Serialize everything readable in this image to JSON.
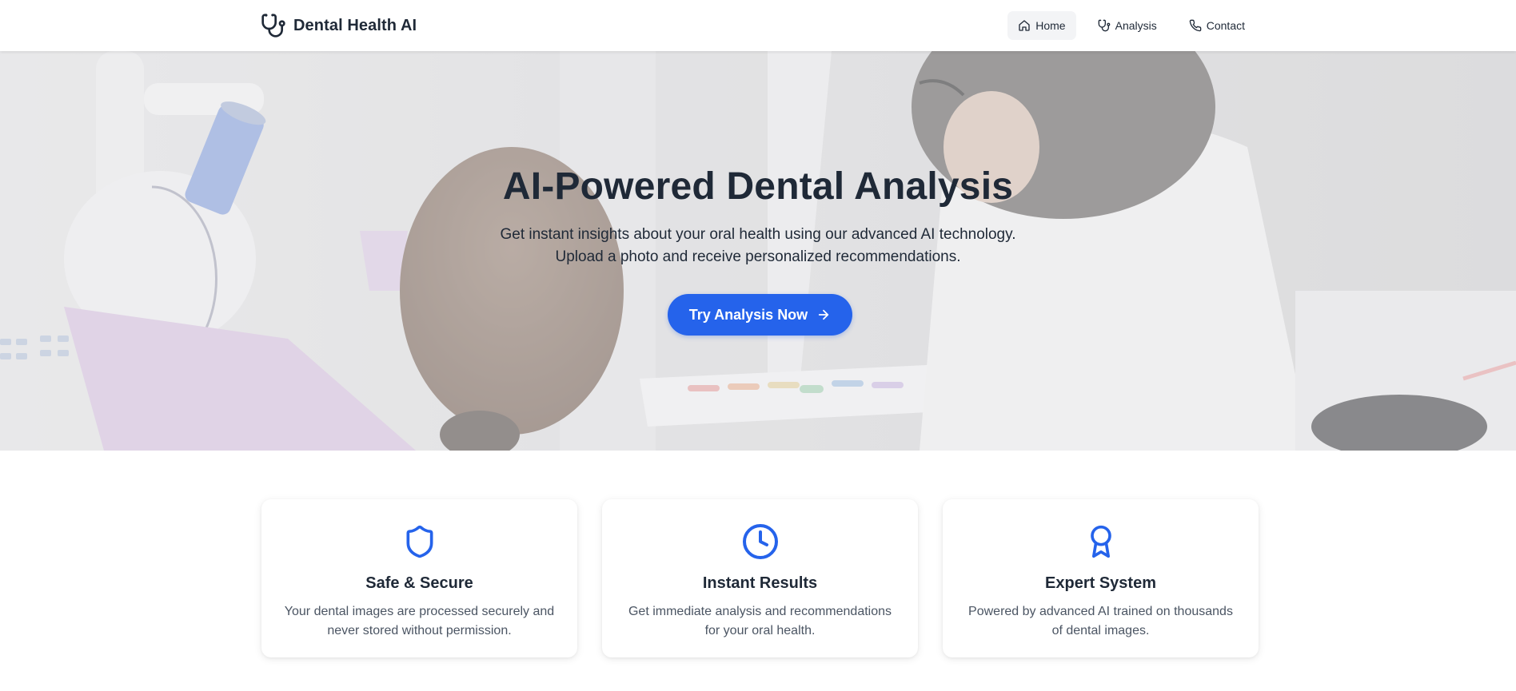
{
  "brand": {
    "name": "Dental Health AI",
    "icon": "stethoscope-icon"
  },
  "nav": [
    {
      "label": "Home",
      "icon": "home-icon",
      "active": true
    },
    {
      "label": "Analysis",
      "icon": "stethoscope-icon",
      "active": false
    },
    {
      "label": "Contact",
      "icon": "phone-icon",
      "active": false
    }
  ],
  "hero": {
    "title": "AI-Powered Dental Analysis",
    "subtitle": "Get instant insights about your oral health using our advanced AI technology. Upload a photo and receive personalized recommendations.",
    "cta_label": "Try Analysis Now",
    "cta_icon": "arrow-right-icon"
  },
  "features": [
    {
      "icon": "shield-icon",
      "title": "Safe & Secure",
      "description": "Your dental images are processed securely and never stored without permission."
    },
    {
      "icon": "clock-icon",
      "title": "Instant Results",
      "description": "Get immediate analysis and recommendations for your oral health."
    },
    {
      "icon": "award-icon",
      "title": "Expert System",
      "description": "Powered by advanced AI trained on thousands of dental images."
    }
  ],
  "colors": {
    "accent": "#2563eb",
    "text": "#1f2937",
    "muted": "#4b5563",
    "nav_active_bg": "#f3f4f6"
  }
}
